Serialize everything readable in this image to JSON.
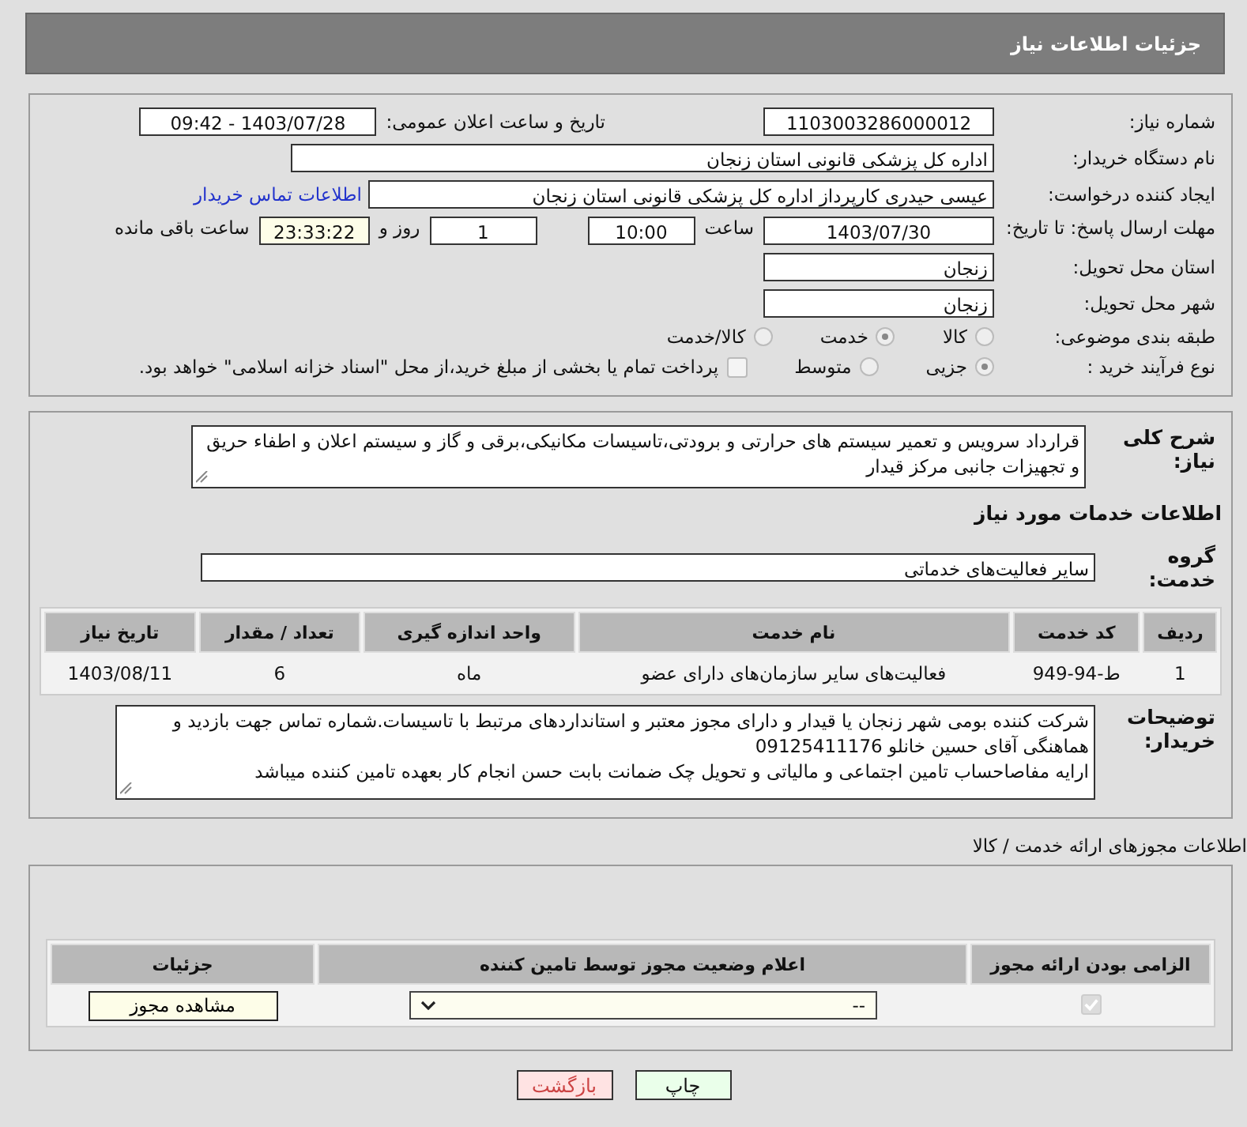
{
  "header": {
    "title": "جزئیات اطلاعات نیاز"
  },
  "need_number": {
    "label": "شماره نیاز:",
    "value": "1103003286000012"
  },
  "announce": {
    "label": "تاریخ و ساعت اعلان عمومی:",
    "value": "1403/07/28 - 09:42"
  },
  "buyer_org": {
    "label": "نام دستگاه خریدار:",
    "value": "اداره کل پزشکی قانونی استان زنجان"
  },
  "requester": {
    "label": "ایجاد کننده درخواست:",
    "value": "عیسی حیدری کارپرداز اداره کل پزشکی قانونی استان زنجان",
    "link": "اطلاعات تماس خریدار"
  },
  "deadline": {
    "label": "مهلت ارسال پاسخ: تا تاریخ:",
    "date": "1403/07/30",
    "time_label": "ساعت",
    "time": "10:00",
    "days": "1",
    "days_label": "روز و",
    "remaining": "23:33:22",
    "remaining_label": "ساعت باقی مانده"
  },
  "province": {
    "label": "استان محل تحویل:",
    "value": "زنجان"
  },
  "city": {
    "label": "شهر محل تحویل:",
    "value": "زنجان"
  },
  "category": {
    "label": "طبقه بندی موضوعی:",
    "options": [
      {
        "label": "کالا",
        "selected": false
      },
      {
        "label": "خدمت",
        "selected": true
      },
      {
        "label": "کالا/خدمت",
        "selected": false
      }
    ]
  },
  "process": {
    "label": "نوع فرآیند خرید :",
    "options": [
      {
        "label": "جزیی",
        "selected": true
      },
      {
        "label": "متوسط",
        "selected": false
      }
    ],
    "payment": {
      "checked": false,
      "label": "پرداخت تمام یا بخشی از مبلغ خرید،از محل \"اسناد خزانه اسلامی\" خواهد بود."
    }
  },
  "description": {
    "label": "شرح کلی نیاز:",
    "value": "قرارداد سرویس و تعمیر سیستم های حرارتی و برودتی،تاسیسات مکانیکی،برقی و گاز و سیستم اعلان و اطفاء حریق و تجهیزات جانبی مرکز قیدار"
  },
  "services": {
    "title": "اطلاعات خدمات مورد نیاز",
    "group_label": "گروه خدمت:",
    "group": "سایر فعالیت‌های خدماتی",
    "columns": [
      "ردیف",
      "کد خدمت",
      "نام خدمت",
      "واحد اندازه گیری",
      "تعداد / مقدار",
      "تاریخ نیاز"
    ],
    "rows": [
      [
        "1",
        "ط-94-949",
        "فعالیت‌های سایر سازمان‌های دارای عضو",
        "ماه",
        "6",
        "1403/08/11"
      ]
    ]
  },
  "buyer_notes": {
    "label": "توضیحات خریدار:",
    "lines": [
      "شرکت کننده بومی شهر زنجان یا قیدار و دارای مجوز معتبر و استانداردهای مرتبط با تاسیسات.شماره تماس جهت بازدید و هماهنگی آقای حسین خانلو 09125411176",
      "ارایه مفاصاحساب تامین اجتماعی و مالیاتی و تحویل چک ضمانت بابت حسن انجام کار بعهده تامین کننده میباشد"
    ]
  },
  "licenses": {
    "title": "اطلاعات مجوزهای ارائه خدمت / کالا",
    "columns": [
      "الزامی بودن ارائه مجوز",
      "اعلام وضعیت مجوز توسط تامین کننده",
      "جزئیات"
    ],
    "rows": [
      {
        "required": true,
        "status": "--",
        "button": "مشاهده مجوز"
      }
    ]
  },
  "buttons": [
    {
      "kind": "print",
      "label": "چاپ"
    },
    {
      "kind": "back",
      "label": "بازگشت"
    }
  ]
}
